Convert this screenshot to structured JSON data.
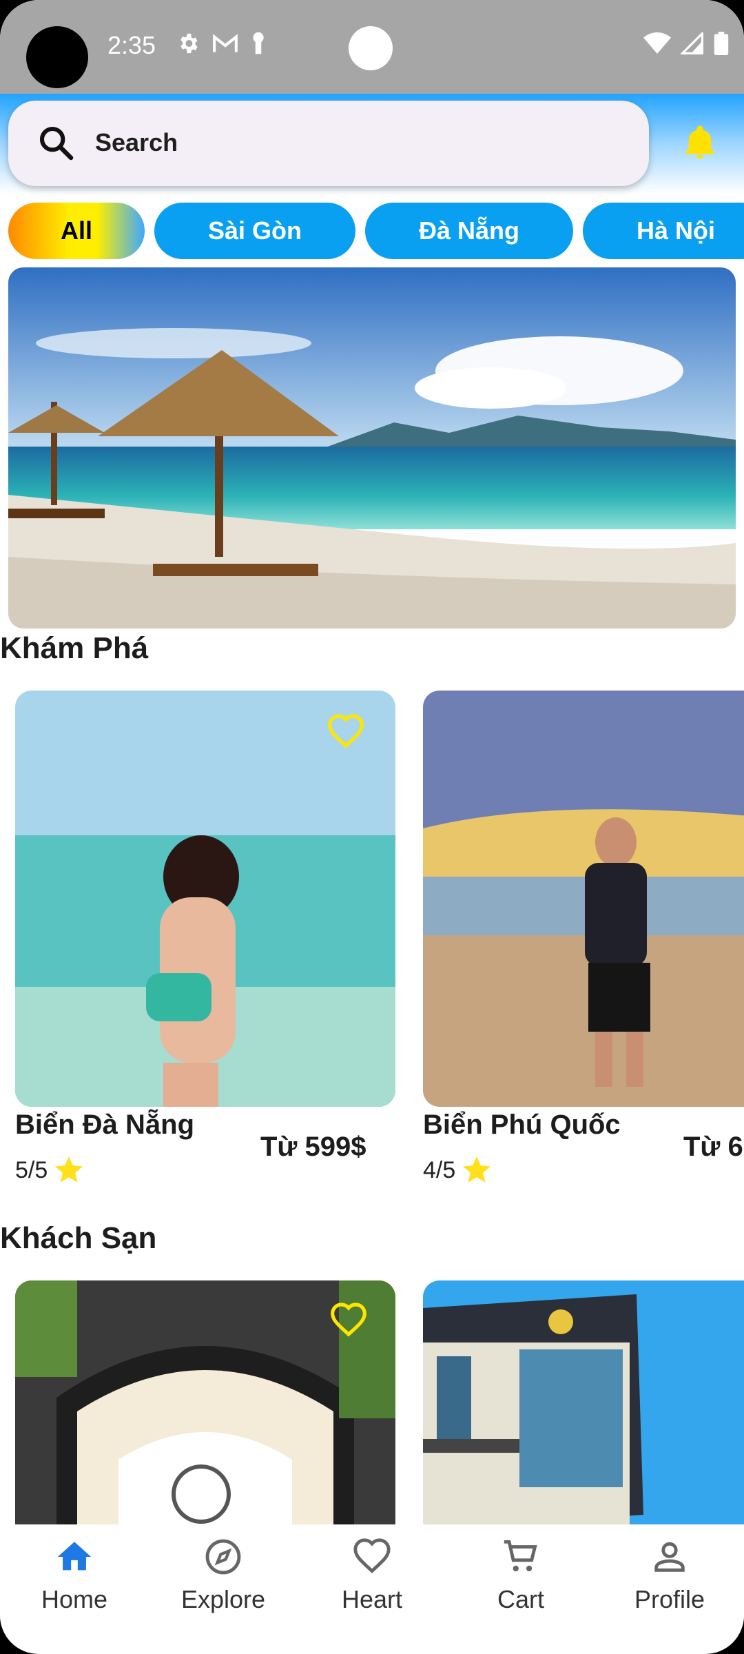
{
  "status_bar": {
    "time": "2:35"
  },
  "search": {
    "placeholder": "Search"
  },
  "chips": [
    {
      "label": "All"
    },
    {
      "label": "Sài Gòn"
    },
    {
      "label": "Đà Nẵng"
    },
    {
      "label": "Hà Nội"
    }
  ],
  "sections": {
    "explore_title": "Khám Phá",
    "hotels_title": "Khách Sạn"
  },
  "explore_cards": [
    {
      "title": "Biển Đà Nẵng",
      "rating": "5/5",
      "price": "Từ 599$"
    },
    {
      "title": "Biển Phú Quốc",
      "rating": "4/5",
      "price": "Từ 6"
    }
  ],
  "bottom_nav": [
    {
      "label": "Home",
      "icon": "home-icon"
    },
    {
      "label": "Explore",
      "icon": "compass-icon"
    },
    {
      "label": "Heart",
      "icon": "heart-icon"
    },
    {
      "label": "Cart",
      "icon": "cart-icon"
    },
    {
      "label": "Profile",
      "icon": "profile-icon"
    }
  ],
  "colors": {
    "accent": "#0aa0f2",
    "heart_yellow": "#ffe600",
    "bell_yellow": "#ffe100",
    "nav_active": "#1e78e6"
  }
}
